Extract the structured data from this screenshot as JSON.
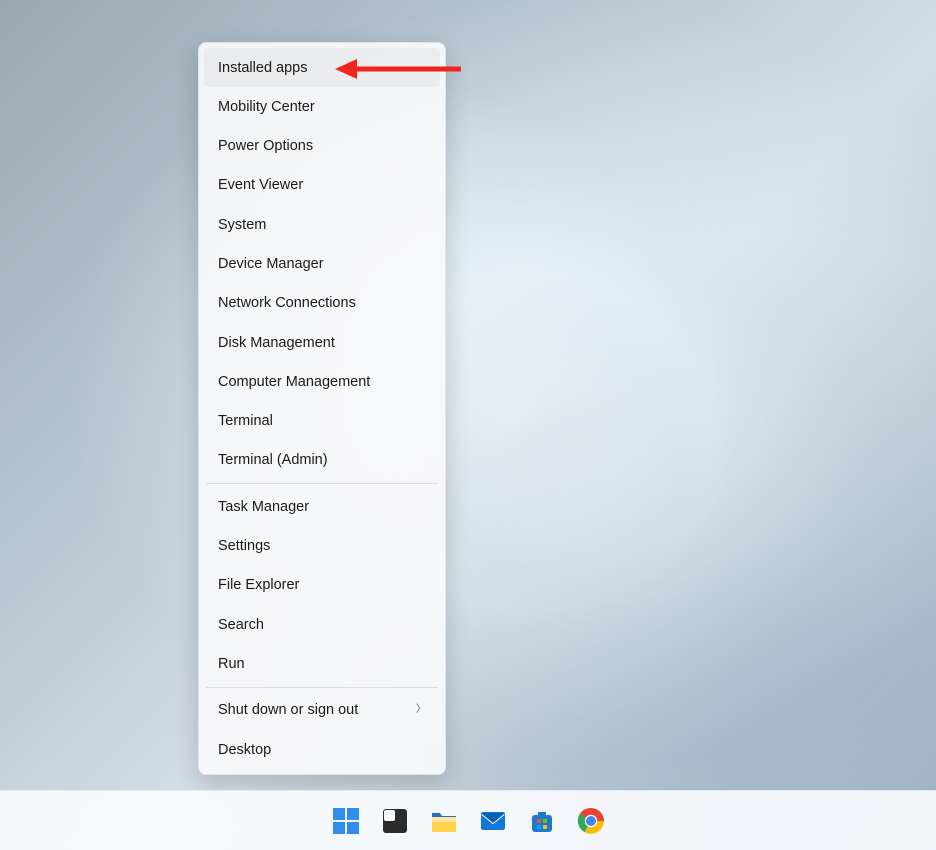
{
  "menu": {
    "groups": [
      [
        {
          "id": "installed-apps",
          "label": "Installed apps",
          "highlight": true
        },
        {
          "id": "mobility-center",
          "label": "Mobility Center"
        },
        {
          "id": "power-options",
          "label": "Power Options"
        },
        {
          "id": "event-viewer",
          "label": "Event Viewer"
        },
        {
          "id": "system",
          "label": "System"
        },
        {
          "id": "device-manager",
          "label": "Device Manager"
        },
        {
          "id": "network-connections",
          "label": "Network Connections"
        },
        {
          "id": "disk-management",
          "label": "Disk Management"
        },
        {
          "id": "computer-management",
          "label": "Computer Management"
        },
        {
          "id": "terminal",
          "label": "Terminal"
        },
        {
          "id": "terminal-admin",
          "label": "Terminal (Admin)"
        }
      ],
      [
        {
          "id": "task-manager",
          "label": "Task Manager"
        },
        {
          "id": "settings",
          "label": "Settings"
        },
        {
          "id": "file-explorer",
          "label": "File Explorer"
        },
        {
          "id": "search",
          "label": "Search"
        },
        {
          "id": "run",
          "label": "Run"
        }
      ],
      [
        {
          "id": "shut-down",
          "label": "Shut down or sign out",
          "submenu": true
        },
        {
          "id": "desktop",
          "label": "Desktop"
        }
      ]
    ]
  },
  "annotation": {
    "target": "installed-apps",
    "color": "#f0251e"
  },
  "taskbar": {
    "items": [
      {
        "id": "start",
        "name": "start-icon"
      },
      {
        "id": "task-view",
        "name": "task-view-icon"
      },
      {
        "id": "file-explorer",
        "name": "file-explorer-icon"
      },
      {
        "id": "mail",
        "name": "mail-icon"
      },
      {
        "id": "store",
        "name": "microsoft-store-icon"
      },
      {
        "id": "chrome",
        "name": "chrome-icon"
      }
    ]
  }
}
